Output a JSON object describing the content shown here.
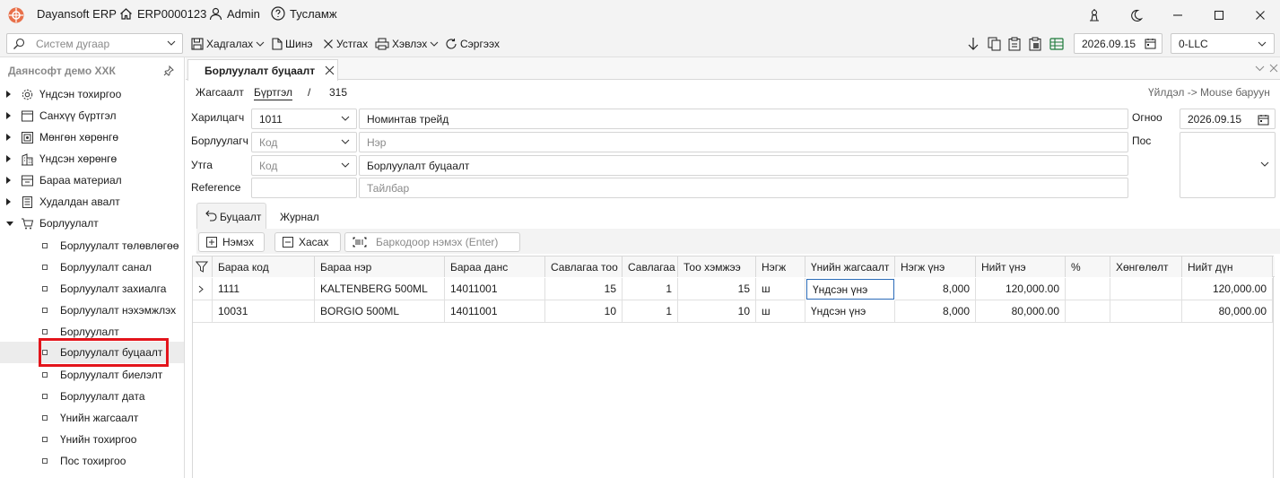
{
  "app": {
    "title": "Dayansoft ERP",
    "company_code": "ERP0000123",
    "user": "Admin",
    "help": "Тусламж"
  },
  "toolbar": {
    "search_placeholder": "Систем дугаар",
    "save": "Хадгалах",
    "new": "Шинэ",
    "delete": "Устгах",
    "print": "Хэвлэх",
    "refresh": "Сэргээх",
    "date": "2026.09.15",
    "company": "0-LLC"
  },
  "sidebar": {
    "title": "Даянсофт демо ХХК",
    "groups": [
      {
        "label": "Үндсэн тохиргоо",
        "icon": "gear-icon"
      },
      {
        "label": "Санхүү бүртгэл",
        "icon": "ledger-icon"
      },
      {
        "label": "Мөнгөн хөрөнгө",
        "icon": "money-icon"
      },
      {
        "label": "Үндсэн хөрөнгө",
        "icon": "building-icon"
      },
      {
        "label": "Бараа материал",
        "icon": "inventory-icon"
      },
      {
        "label": "Худалдан авалт",
        "icon": "purchase-icon"
      },
      {
        "label": "Борлуулалт",
        "icon": "cart-icon"
      }
    ],
    "sales_items": [
      "Борлуулалт төлөвлөгөө",
      "Борлуулалт санал",
      "Борлуулалт захиалга",
      "Борлуулалт нэхэмжлэх",
      "Борлуулалт",
      "Борлуулалт буцаалт",
      "Борлуулалт биелэлт",
      "Борлуулалт дата",
      "Үнийн жагсаалт",
      "Үнийн тохиргоо",
      "Пос тохиргоо"
    ]
  },
  "tab": {
    "title": "Борлуулалт буцаалт"
  },
  "breadcrumb": {
    "list": "Жагсаалт",
    "register": "Бүртгэл",
    "sep": "/",
    "number": "315",
    "hint": "Үйлдэл -> Mouse баруун"
  },
  "form": {
    "customer_label": "Харилцагч",
    "customer_code": "1011",
    "customer_name": "Номинтав трейд",
    "seller_label": "Борлуулагч",
    "seller_code_ph": "Код",
    "seller_name_ph": "Нэр",
    "type_label": "Утга",
    "type_code_ph": "Код",
    "type_value": "Борлуулалт буцаалт",
    "reference_label": "Reference",
    "note_ph": "Тайлбар",
    "date_label": "Огноо",
    "date_value": "2026.09.15",
    "pos_label": "Пос"
  },
  "subtabs": {
    "return": "Буцаалт",
    "journal": "Журнал"
  },
  "grid_toolbar": {
    "add": "Нэмэх",
    "remove": "Хасах",
    "barcode_ph": "Баркодоор нэмэх (Enter)"
  },
  "grid": {
    "columns": [
      "Бараа код",
      "Бараа нэр",
      "Бараа данс",
      "Савлагаа тоо",
      "Савлагаа",
      "Тоо хэмжээ",
      "Нэгж",
      "Үнийн жагсаалт",
      "Нэгж үнэ",
      "Нийт үнэ",
      "%",
      "Хөнгөлөлт",
      "Нийт дүн"
    ],
    "rows": [
      [
        "1111",
        "KALTENBERG 500ML",
        "14011001",
        "15",
        "1",
        "15",
        "ш",
        "Үндсэн үнэ",
        "8,000",
        "120,000.00",
        "",
        "",
        "120,000.00"
      ],
      [
        "10031",
        "BORGIO 500ML",
        "14011001",
        "10",
        "1",
        "10",
        "ш",
        "Үндсэн үнэ",
        "8,000",
        "80,000.00",
        "",
        "",
        "80,000.00"
      ]
    ]
  }
}
